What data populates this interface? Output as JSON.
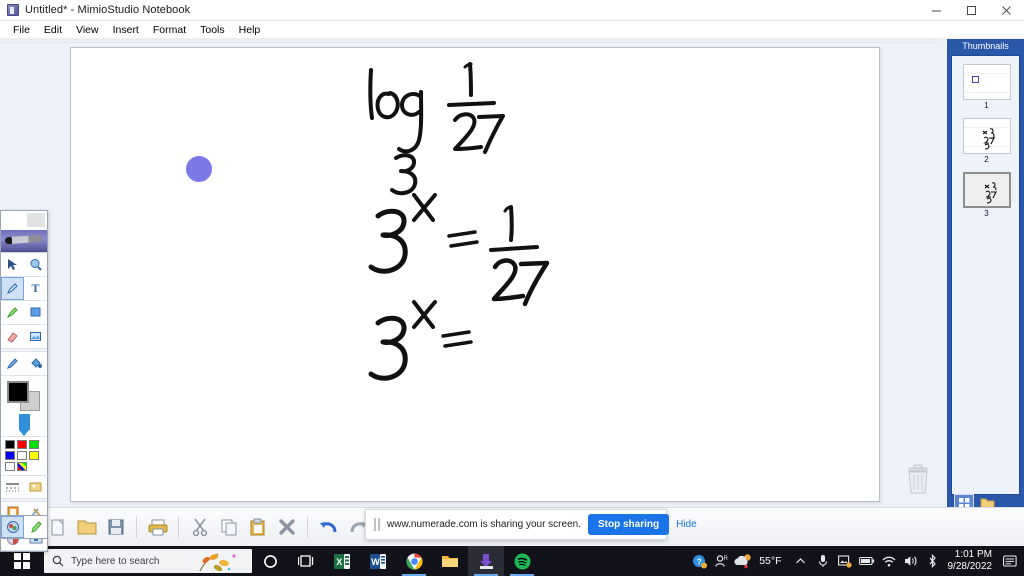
{
  "window": {
    "title": "Untitled* - MimioStudio Notebook",
    "icon": "mimio-notebook-icon",
    "controls": {
      "minimize": "–",
      "maximize": "☐",
      "close": "✕"
    }
  },
  "menubar": {
    "items": [
      {
        "label": "File"
      },
      {
        "label": "Edit"
      },
      {
        "label": "View"
      },
      {
        "label": "Insert"
      },
      {
        "label": "Format"
      },
      {
        "label": "Tools"
      },
      {
        "label": "Help"
      }
    ]
  },
  "canvas": {
    "handwriting": [
      {
        "line": 1,
        "text": "log₃ 1/27"
      },
      {
        "line": 2,
        "text": "3ˣ = 1/27"
      },
      {
        "line": 3,
        "text": "3ˣ ="
      }
    ],
    "cursor": {
      "name": "pen-cursor-dot",
      "color": "#7b79e8"
    },
    "trash": {
      "name": "trash-icon"
    }
  },
  "palette": {
    "tools": [
      {
        "name": "select-tool",
        "glyph": "➤",
        "selected": false
      },
      {
        "name": "zoom-tool",
        "glyph": "🔍",
        "selected": false
      },
      {
        "name": "pen-tool",
        "glyph": "✎",
        "selected": true
      },
      {
        "name": "text-tool",
        "glyph": "T",
        "selected": false
      },
      {
        "name": "highlighter-tool",
        "glyph": "╱",
        "selected": false
      },
      {
        "name": "shape-tool",
        "glyph": "▣",
        "selected": false
      },
      {
        "name": "eraser-tool",
        "glyph": "▱",
        "selected": false
      },
      {
        "name": "image-tool",
        "glyph": "🖼",
        "selected": false
      },
      {
        "name": "ink-pen-tool",
        "glyph": "✒",
        "selected": false
      },
      {
        "name": "fill-tool",
        "glyph": "◕",
        "selected": false
      }
    ],
    "colors": {
      "foreground": "#000000",
      "background": "#cfcfcf",
      "swatches": [
        "#000000",
        "#ff0000",
        "#00e000",
        "#0000ee",
        "#ffffff",
        "#ffff00",
        "#ffffff",
        "#ff00ff"
      ]
    },
    "extras": [
      {
        "name": "line-style-tool",
        "glyph": "≡"
      },
      {
        "name": "gallery-tool",
        "glyph": "🖼"
      },
      {
        "name": "screen-annotation-tool",
        "glyph": "📝"
      },
      {
        "name": "tools-collection",
        "glyph": "✂"
      },
      {
        "name": "reveal-tool",
        "glyph": "◑"
      },
      {
        "name": "spotlight-tool",
        "glyph": "■"
      },
      {
        "name": "recorder-tool",
        "glyph": "◉"
      },
      {
        "name": "pointer-tool",
        "glyph": "↗"
      }
    ]
  },
  "thumbnails": {
    "title": "Thumbnails",
    "pages": [
      {
        "number": "1",
        "selected": false,
        "content": "blank-with-square"
      },
      {
        "number": "2",
        "selected": false,
        "content": "handwriting"
      },
      {
        "number": "3",
        "selected": true,
        "content": "handwriting"
      }
    ],
    "footer": [
      {
        "name": "grid-view-button",
        "glyph": "⊞",
        "selected": true
      },
      {
        "name": "folder-button",
        "glyph": "📁",
        "selected": false
      }
    ]
  },
  "bottom_toolbar": {
    "buttons": [
      {
        "name": "new-button",
        "glyph": "🗋"
      },
      {
        "name": "open-button",
        "glyph": "📂"
      },
      {
        "name": "save-button",
        "glyph": "💾"
      },
      {
        "name": "print-button",
        "glyph": "🖨"
      },
      {
        "name": "cut-button",
        "glyph": "✂"
      },
      {
        "name": "copy-button",
        "glyph": "⧉"
      },
      {
        "name": "paste-button",
        "glyph": "📋"
      },
      {
        "name": "delete-button",
        "glyph": "✖"
      },
      {
        "name": "undo-button",
        "glyph": "↩"
      },
      {
        "name": "redo-button",
        "glyph": "↪"
      },
      {
        "name": "new-page-button",
        "glyph": "➕"
      },
      {
        "name": "duplicate-page-button",
        "glyph": "⧉"
      },
      {
        "name": "previous-page-button",
        "glyph": "←"
      },
      {
        "name": "next-page-button",
        "glyph": "→"
      }
    ]
  },
  "share_bar": {
    "message": "www.numerade.com is sharing your screen.",
    "stop_label": "Stop sharing",
    "hide_label": "Hide",
    "accent": "#1a73e8"
  },
  "taskbar": {
    "start": "windows-logo",
    "search_placeholder": "Type here to search",
    "icons": [
      {
        "name": "cortana-icon",
        "glyph": "○"
      },
      {
        "name": "task-view-icon",
        "glyph": "⧉"
      },
      {
        "name": "excel-icon",
        "glyph": "X"
      },
      {
        "name": "word-icon",
        "glyph": "W"
      },
      {
        "name": "chrome-icon",
        "glyph": "◉"
      },
      {
        "name": "file-explorer-icon",
        "glyph": "📁"
      },
      {
        "name": "mimiostudio-icon",
        "glyph": "⬇"
      },
      {
        "name": "spotify-icon",
        "glyph": "♪"
      }
    ],
    "tray": [
      {
        "name": "help-icon",
        "glyph": "?"
      },
      {
        "name": "people-icon",
        "glyph": "ʀ"
      },
      {
        "name": "show-hidden-icons",
        "glyph": "⌃"
      },
      {
        "name": "microphone-icon",
        "glyph": "⬤"
      },
      {
        "name": "photos-icon",
        "glyph": "◰"
      },
      {
        "name": "battery-icon",
        "glyph": "▭"
      },
      {
        "name": "wifi-icon",
        "glyph": "◠"
      },
      {
        "name": "volume-icon",
        "glyph": "🔈"
      },
      {
        "name": "bluetooth-icon",
        "glyph": "Ƀ"
      }
    ],
    "weather": {
      "temperature": "55°F",
      "condition": "partly-cloudy"
    },
    "clock": {
      "time": "1:01 PM",
      "date": "9/28/2022"
    },
    "notifications": "action-center-icon"
  }
}
